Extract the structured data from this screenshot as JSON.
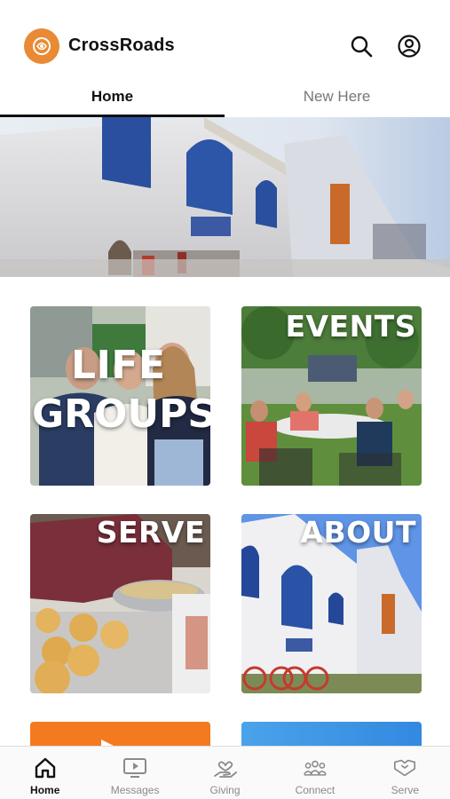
{
  "app": {
    "name": "CrossRoads",
    "brand_color": "#e98a34"
  },
  "header": {
    "search_icon": "search-icon",
    "account_icon": "account-icon"
  },
  "tabs": [
    {
      "label": "Home",
      "active": true
    },
    {
      "label": "New Here",
      "active": false
    }
  ],
  "hero": {
    "image": "watercolor church building"
  },
  "tiles": [
    {
      "line1": "LIFE",
      "line2": "GROUPS"
    },
    {
      "label": "EVENTS"
    },
    {
      "label": "SERVE"
    },
    {
      "label": "ABOUT"
    }
  ],
  "promo": {
    "left_color": "#f47a1f",
    "right_color": "#3f96e6"
  },
  "tabbar": [
    {
      "label": "Home",
      "icon": "home-icon",
      "active": true
    },
    {
      "label": "Messages",
      "icon": "messages-tv-icon",
      "active": false
    },
    {
      "label": "Giving",
      "icon": "giving-hand-heart-icon",
      "active": false
    },
    {
      "label": "Connect",
      "icon": "connect-people-icon",
      "active": false
    },
    {
      "label": "Serve",
      "icon": "serve-handshake-icon",
      "active": false
    }
  ]
}
